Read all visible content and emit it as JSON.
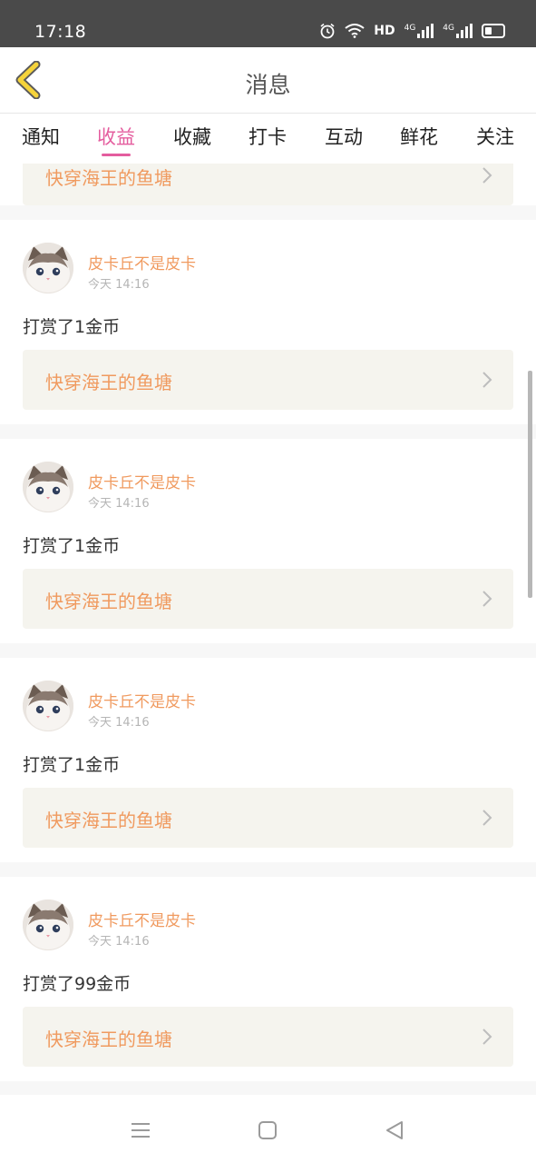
{
  "status_bar": {
    "time": "17:18",
    "network_label": "HD",
    "net_4g_1": "4G",
    "net_4g_2": "4G"
  },
  "header": {
    "title": "消息"
  },
  "tabs": [
    {
      "label": "通知"
    },
    {
      "label": "收益",
      "active": true
    },
    {
      "label": "收藏"
    },
    {
      "label": "打卡"
    },
    {
      "label": "互动"
    },
    {
      "label": "鲜花"
    },
    {
      "label": "关注"
    }
  ],
  "partial_item": {
    "book": "快穿海王的鱼塘"
  },
  "items": [
    {
      "user": "皮卡丘不是皮卡",
      "time": "今天 14:16",
      "message": "打赏了1金币",
      "book": "快穿海王的鱼塘"
    },
    {
      "user": "皮卡丘不是皮卡",
      "time": "今天 14:16",
      "message": "打赏了1金币",
      "book": "快穿海王的鱼塘"
    },
    {
      "user": "皮卡丘不是皮卡",
      "time": "今天 14:16",
      "message": "打赏了1金币",
      "book": "快穿海王的鱼塘"
    },
    {
      "user": "皮卡丘不是皮卡",
      "time": "今天 14:16",
      "message": "打赏了99金币",
      "book": "快穿海王的鱼塘"
    }
  ],
  "colors": {
    "accent": "#e45d9e",
    "username": "#f09a5f",
    "book_link_bg": "#f5f4ee"
  }
}
